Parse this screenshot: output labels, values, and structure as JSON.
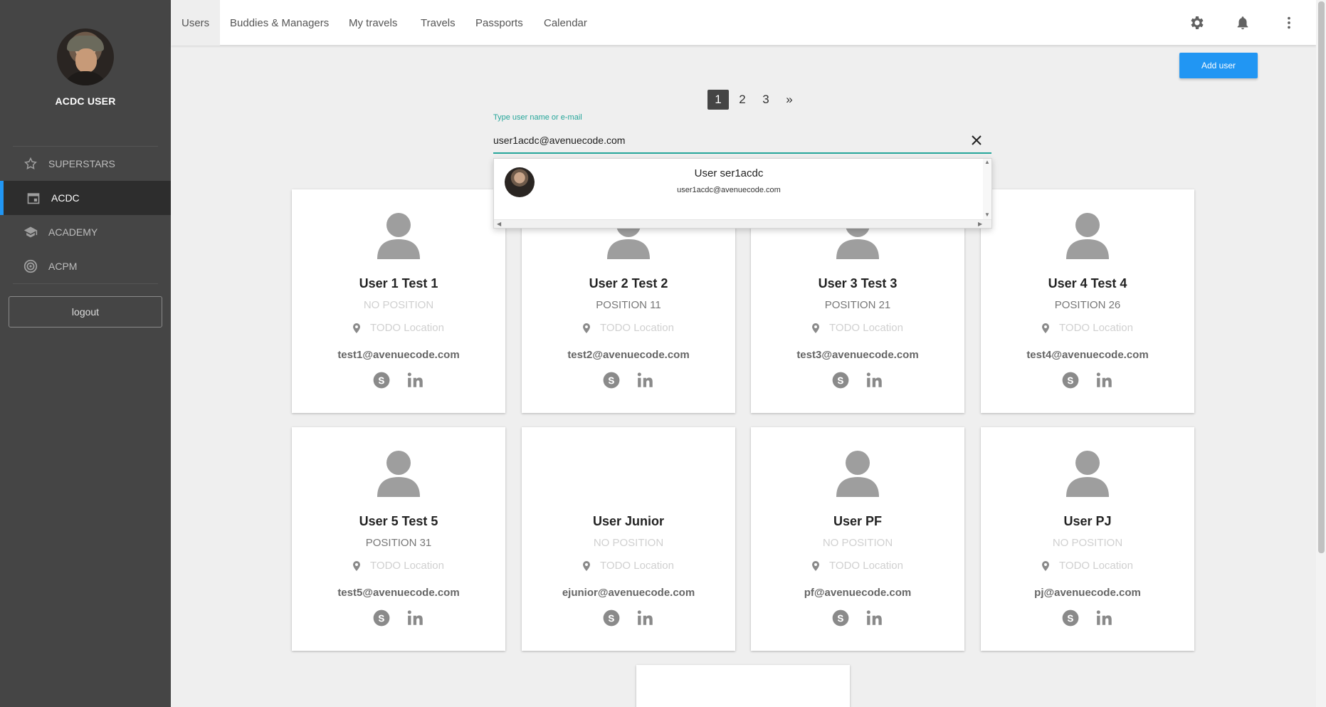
{
  "sidebar": {
    "username": "ACDC USER",
    "avatar_icon": "user-photo",
    "items": [
      {
        "label": "SUPERSTARS",
        "icon": "star-icon",
        "active": false
      },
      {
        "label": "ACDC",
        "icon": "calendar-icon",
        "active": true
      },
      {
        "label": "ACADEMY",
        "icon": "school-icon",
        "active": false
      },
      {
        "label": "ACPM",
        "icon": "target-icon",
        "active": false
      }
    ],
    "logout_label": "logout"
  },
  "header": {
    "tabs": [
      {
        "label": "Users",
        "active": true
      },
      {
        "label": "Buddies & Managers",
        "active": false
      },
      {
        "label": "My travels",
        "active": false
      },
      {
        "label": "Travels",
        "active": false
      },
      {
        "label": "Passports",
        "active": false
      },
      {
        "label": "Calendar",
        "active": false
      }
    ],
    "icons": [
      "settings-icon",
      "bell-icon",
      "more-vert-icon"
    ]
  },
  "add_user_label": "Add user",
  "pagination": {
    "pages": [
      "1",
      "2",
      "3"
    ],
    "next": "»",
    "current": "1"
  },
  "search": {
    "label": "Type user name or e-mail",
    "value": "user1acdc@avenuecode.com"
  },
  "suggestion": {
    "name": "User ser1acdc",
    "email": "user1acdc@avenuecode.com"
  },
  "cards": [
    {
      "name": "User 1 Test 1",
      "position": "NO POSITION",
      "location": "TODO Location",
      "email": "test1@avenuecode.com",
      "has_photo": true
    },
    {
      "name": "User 2 Test 2",
      "position": "POSITION 11",
      "location": "TODO Location",
      "email": "test2@avenuecode.com",
      "has_photo": true
    },
    {
      "name": "User 3 Test 3",
      "position": "POSITION 21",
      "location": "TODO Location",
      "email": "test3@avenuecode.com",
      "has_photo": true
    },
    {
      "name": "User 4 Test 4",
      "position": "POSITION 26",
      "location": "TODO Location",
      "email": "test4@avenuecode.com",
      "has_photo": true
    },
    {
      "name": "User 5 Test 5",
      "position": "POSITION 31",
      "location": "TODO Location",
      "email": "test5@avenuecode.com",
      "has_photo": true
    },
    {
      "name": "User Junior",
      "position": "NO POSITION",
      "location": "TODO Location",
      "email": "ejunior@avenuecode.com",
      "has_photo": false
    },
    {
      "name": "User PF",
      "position": "NO POSITION",
      "location": "TODO Location",
      "email": "pf@avenuecode.com",
      "has_photo": true
    },
    {
      "name": "User PJ",
      "position": "NO POSITION",
      "location": "TODO Location",
      "email": "pj@avenuecode.com",
      "has_photo": true
    }
  ],
  "colors": {
    "sidebar_bg": "#454545",
    "accent_blue": "#2196f3",
    "teal": "#26a69a"
  }
}
